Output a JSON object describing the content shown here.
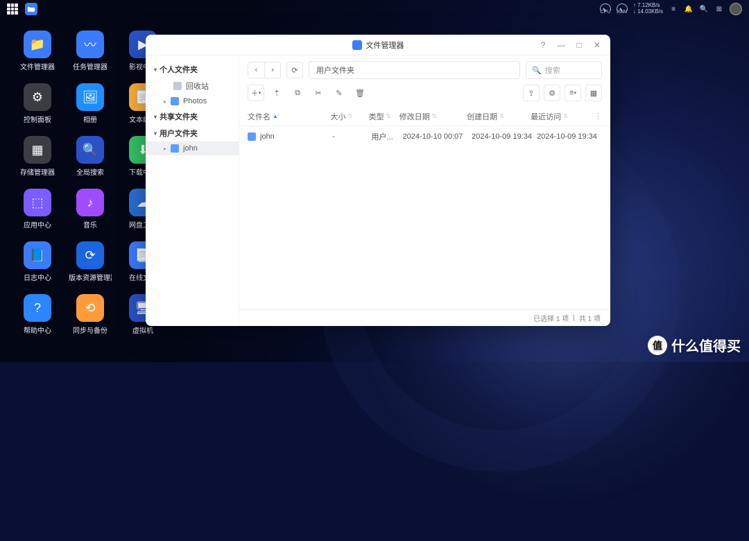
{
  "topbar": {
    "cpu_label": "CPU",
    "ram_label": "RAM",
    "net_up": "↑ 7.12KB/s",
    "net_down": "↓ 14.03KB/s"
  },
  "desktop": {
    "icons": [
      {
        "label": "文件管理器",
        "bg": "#3b7cff",
        "glyph": "📁"
      },
      {
        "label": "任务管理器",
        "bg": "#3b7cff",
        "glyph": "〰"
      },
      {
        "label": "影视中心",
        "bg": "#2a52c8",
        "glyph": "▶"
      },
      {
        "label": "控制面板",
        "bg": "#3a3d44",
        "glyph": "⚙"
      },
      {
        "label": "相册",
        "bg": "#1f8fff",
        "glyph": "🖼"
      },
      {
        "label": "文本编辑",
        "bg": "#ffae3b",
        "glyph": "📄"
      },
      {
        "label": "存储管理器",
        "bg": "#3a3d44",
        "glyph": "▦"
      },
      {
        "label": "全局搜索",
        "bg": "#2a52c8",
        "glyph": "🔍"
      },
      {
        "label": "下载中心",
        "bg": "#35c466",
        "glyph": "⬇"
      },
      {
        "label": "应用中心",
        "bg": "#7a5cff",
        "glyph": "⬚"
      },
      {
        "label": "音乐",
        "bg": "#a04bff",
        "glyph": "♪"
      },
      {
        "label": "网盘工具",
        "bg": "#2a6fd6",
        "glyph": "☁"
      },
      {
        "label": "日志中心",
        "bg": "#3b7cff",
        "glyph": "📘"
      },
      {
        "label": "版本资源管理器",
        "bg": "#1b66e0",
        "glyph": "⟳"
      },
      {
        "label": "在线文档",
        "bg": "#3b7cff",
        "glyph": "📑"
      },
      {
        "label": "帮助中心",
        "bg": "#2b86ff",
        "glyph": "?"
      },
      {
        "label": "同步与备份",
        "bg": "#ff9b3b",
        "glyph": "⟲"
      },
      {
        "label": "虚拟机",
        "bg": "#2a52c8",
        "glyph": "🖥"
      }
    ]
  },
  "window": {
    "title": "文件管理器",
    "breadcrumb": "用户文件夹",
    "search_placeholder": "搜索",
    "sidebar": {
      "sections": [
        {
          "label": "个人文件夹",
          "items": [
            {
              "label": "回收站",
              "icon": "gray"
            },
            {
              "label": "Photos",
              "icon": "blue",
              "expandable": true
            }
          ]
        },
        {
          "label": "共享文件夹",
          "items": []
        },
        {
          "label": "用户文件夹",
          "items": [
            {
              "label": "john",
              "icon": "blue",
              "expandable": true,
              "selected": true
            }
          ]
        }
      ]
    },
    "columns": {
      "name": "文件名",
      "size": "大小",
      "type": "类型",
      "modified": "修改日期",
      "created": "创建日期",
      "accessed": "最近访问"
    },
    "rows": [
      {
        "name": "john",
        "size": "-",
        "type": "用户...",
        "modified": "2024-10-10 00:07",
        "created": "2024-10-09 19:34",
        "accessed": "2024-10-09 19:34"
      }
    ],
    "status_selected": "已选择 1 项",
    "status_total": "共 1 项"
  },
  "watermark": {
    "badge": "值",
    "text": "什么值得买"
  }
}
